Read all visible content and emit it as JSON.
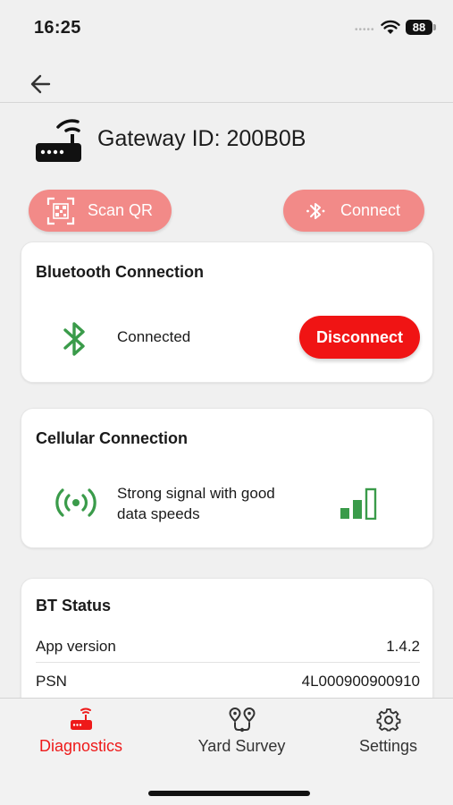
{
  "status_bar": {
    "time": "16:25",
    "battery": "88",
    "dots": "•••••"
  },
  "header": {
    "gateway_title": "Gateway ID: 200B0B"
  },
  "actions": {
    "scan_label": "Scan QR",
    "connect_label": "Connect"
  },
  "bluetooth": {
    "title": "Bluetooth Connection",
    "status": "Connected",
    "disconnect_label": "Disconnect"
  },
  "cellular": {
    "title": "Cellular Connection",
    "status": "Strong signal with good data speeds",
    "signal_level": 3
  },
  "bt_status": {
    "title": "BT Status",
    "rows": [
      {
        "key": "App version",
        "value": "1.4.2"
      },
      {
        "key": "PSN",
        "value": "4L000900900910"
      }
    ]
  },
  "tabs": [
    {
      "label": "Diagnostics",
      "active": true
    },
    {
      "label": "Yard Survey",
      "active": false
    },
    {
      "label": "Settings",
      "active": false
    }
  ],
  "colors": {
    "accent": "#ee1a1a",
    "pill": "#f28a88",
    "success": "#3a9b4a",
    "disconnect": "#f01414"
  }
}
